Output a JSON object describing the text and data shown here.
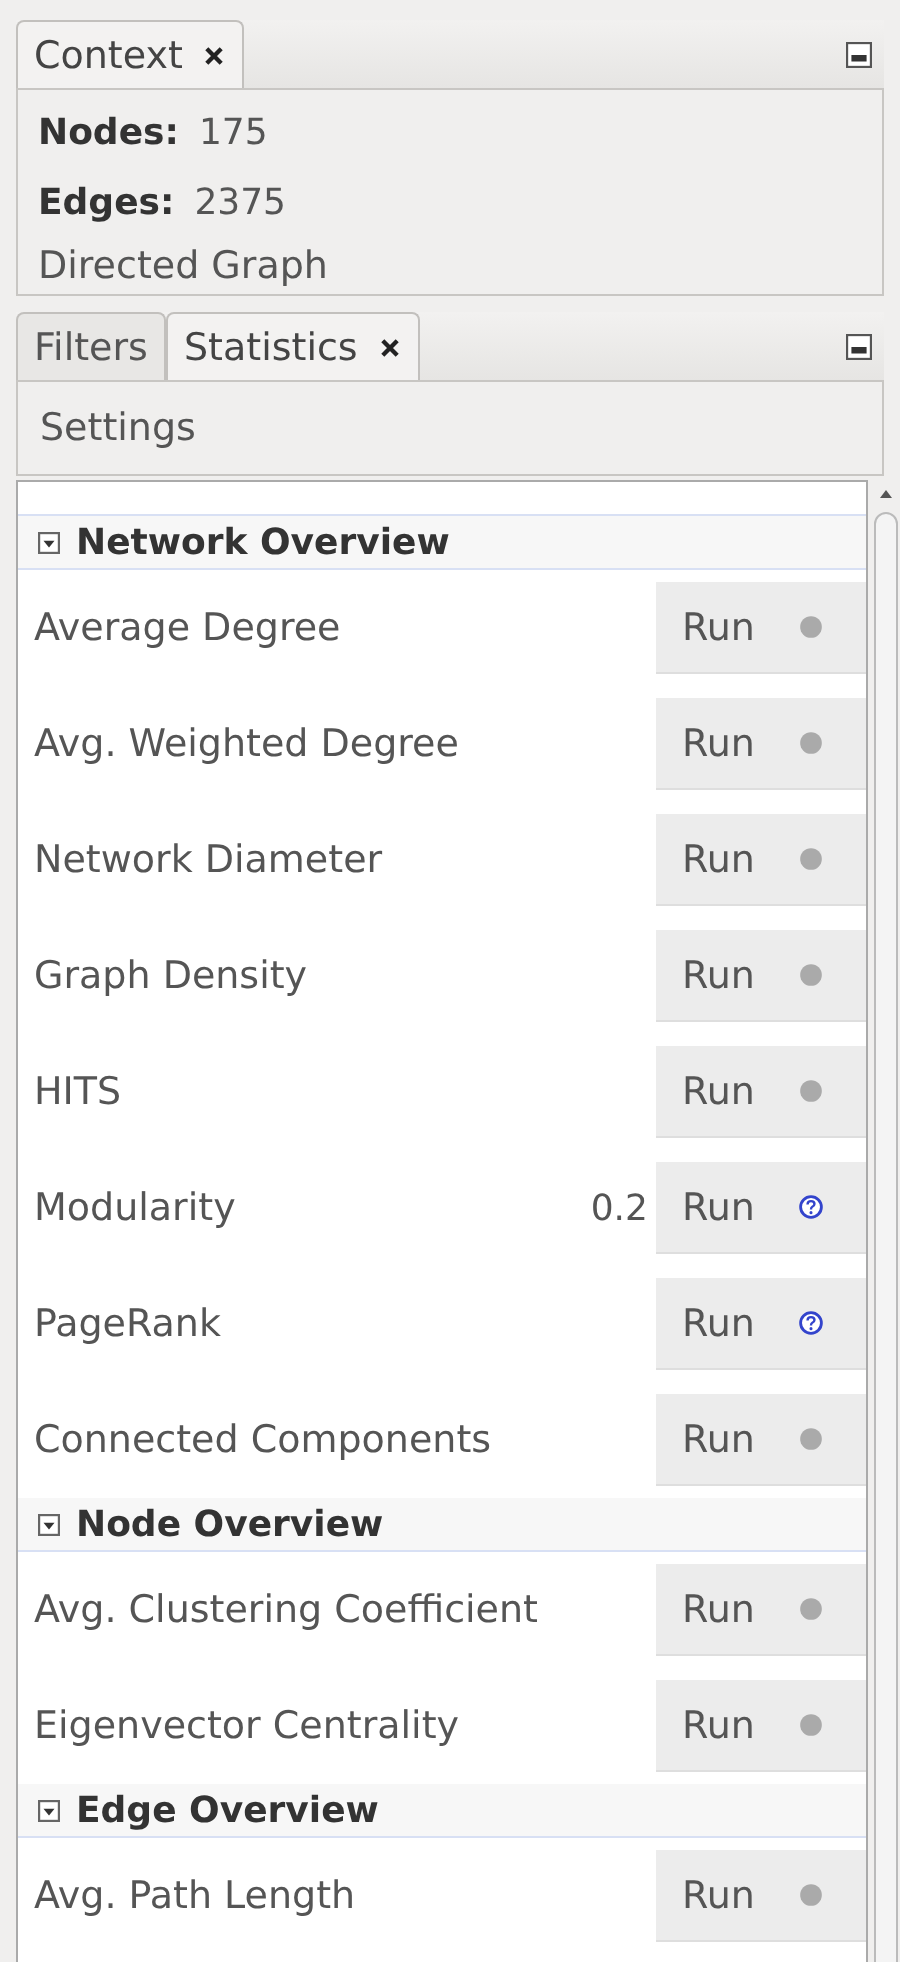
{
  "context_panel": {
    "tabs": [
      {
        "label": "Context",
        "selected": true,
        "closable": true
      }
    ],
    "nodes": {
      "label": "Nodes:",
      "value": "175"
    },
    "edges": {
      "label": "Edges:",
      "value": "2375"
    },
    "graph_type": "Directed Graph"
  },
  "statistics_panel": {
    "tabs": [
      {
        "label": "Filters",
        "selected": false,
        "closable": false
      },
      {
        "label": "Statistics",
        "selected": true,
        "closable": true
      }
    ],
    "settings": "Settings",
    "sections": [
      {
        "title": "Network Overview",
        "expanded": true,
        "rows": [
          {
            "name": "Average Degree",
            "button": "Run",
            "report": false
          },
          {
            "name": "Avg. Weighted Degree",
            "button": "Run",
            "report": false
          },
          {
            "name": "Network Diameter",
            "button": "Run",
            "report": false
          },
          {
            "name": "Graph Density",
            "button": "Run",
            "report": false
          },
          {
            "name": "HITS",
            "button": "Run",
            "report": false
          },
          {
            "name": "Modularity",
            "result": "0.2",
            "button": "Run",
            "report": true
          },
          {
            "name": "PageRank",
            "button": "Run",
            "report": true
          },
          {
            "name": "Connected Components",
            "button": "Run",
            "report": false
          }
        ]
      },
      {
        "title": "Node Overview",
        "expanded": true,
        "rows": [
          {
            "name": "Avg. Clustering Coefficient",
            "button": "Run",
            "report": false
          },
          {
            "name": "Eigenvector Centrality",
            "button": "Run",
            "report": false
          }
        ]
      },
      {
        "title": "Edge Overview",
        "expanded": true,
        "rows": [
          {
            "name": "Avg. Path Length",
            "button": "Run",
            "report": false
          }
        ]
      }
    ]
  }
}
